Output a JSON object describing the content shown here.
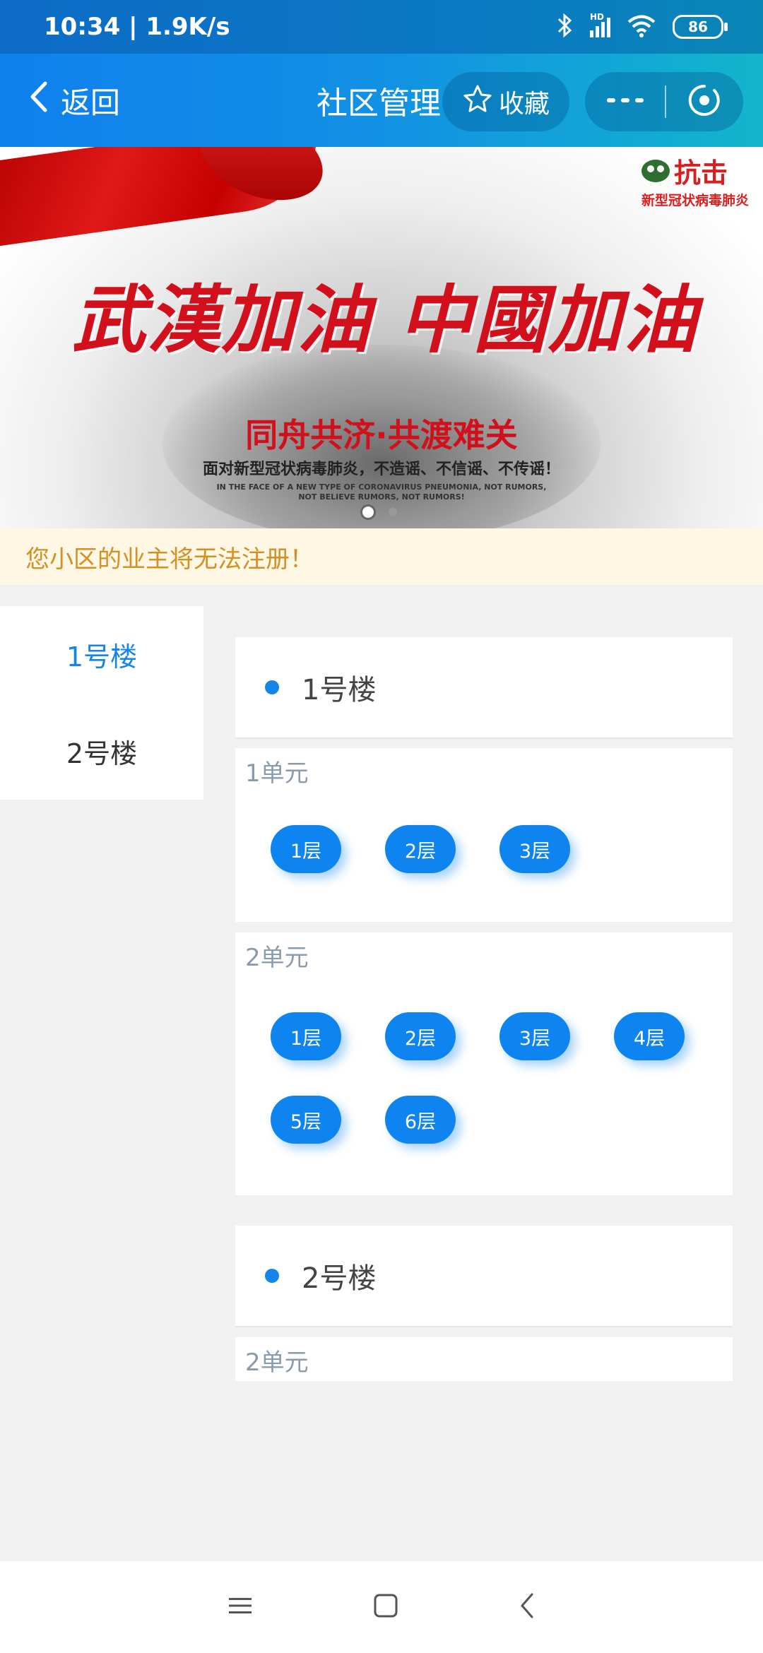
{
  "status_bar": {
    "time": "10:34 | 1.9K/s",
    "network": "HD",
    "battery": "86"
  },
  "nav": {
    "back_label": "返回",
    "title": "社区管理",
    "favorite_label": "收藏",
    "icons": [
      "chevron-left-icon",
      "star-icon",
      "more-icon",
      "close-circle-icon"
    ]
  },
  "banner": {
    "logo_big": "抗击",
    "logo_small": "新型冠状病毒肺炎",
    "slogan_main": "武漢加油 中國加油",
    "slogan_sub": "同舟共济·共渡难关",
    "slogan_line": "面对新型冠状病毒肺炎，不造谣、不信谣、不传谣！",
    "slogan_en_1": "IN THE FACE OF A NEW TYPE OF CORONAVIRUS PNEUMONIA, NOT RUMORS,",
    "slogan_en_2": "NOT BELIEVE RUMORS, NOT RUMORS!",
    "slide_count": 2,
    "active_slide": 1
  },
  "notice": "您小区的业主将无法注册！",
  "side_menu": {
    "items": [
      {
        "label": "1号楼",
        "active": true
      },
      {
        "label": "2号楼",
        "active": false
      }
    ]
  },
  "buildings": [
    {
      "title": "1号楼",
      "units": [
        {
          "title": "1单元",
          "floors": [
            "1层",
            "2层",
            "3层"
          ]
        },
        {
          "title": "2单元",
          "floors": [
            "1层",
            "2层",
            "3层",
            "4层",
            "5层",
            "6层"
          ]
        }
      ]
    },
    {
      "title": "2号楼",
      "units": [
        {
          "title": "2单元",
          "floors": []
        }
      ]
    }
  ],
  "system_nav": {
    "icons": [
      "menu-icon",
      "home-square-icon",
      "back-icon"
    ]
  },
  "colors": {
    "accent": "#1585e8",
    "notice_text": "#d39025",
    "notice_bg": "#fdf7e4",
    "banner_red": "#d2101c"
  }
}
